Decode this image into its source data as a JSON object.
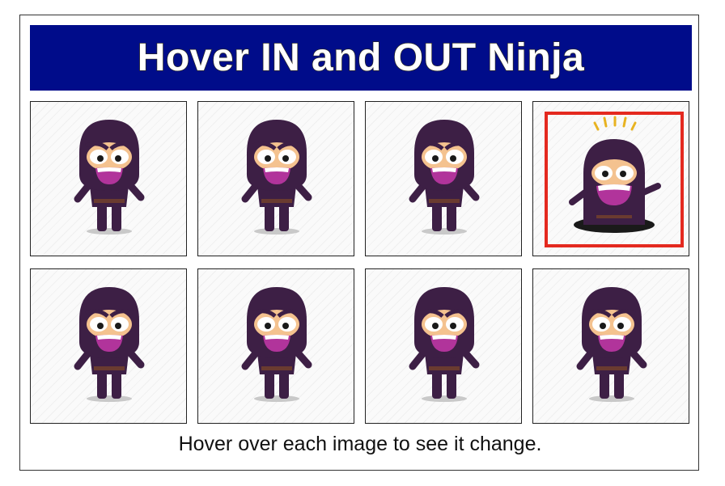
{
  "title": "Hover IN and OUT Ninja",
  "caption": "Hover over each image to see it change.",
  "tiles": [
    {
      "state": "standing"
    },
    {
      "state": "standing"
    },
    {
      "state": "standing"
    },
    {
      "state": "popping-out-of-hole",
      "highlighted": true
    },
    {
      "state": "standing"
    },
    {
      "state": "standing"
    },
    {
      "state": "standing"
    },
    {
      "state": "standing"
    }
  ],
  "colors": {
    "banner": "#000c8a",
    "highlight": "#e4291f",
    "ninja_body": "#3d1f45",
    "mouth": "#b1349b",
    "skin": "#f4c28f"
  }
}
